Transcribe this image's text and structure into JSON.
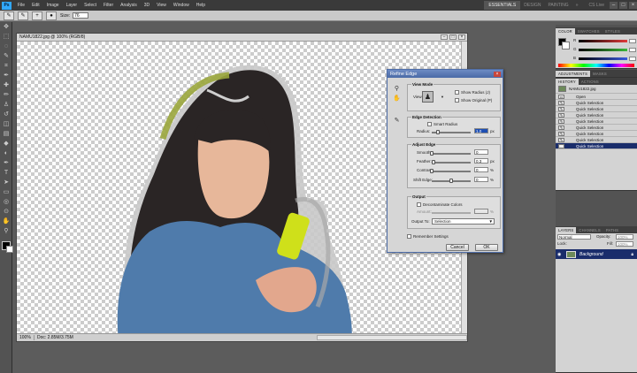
{
  "menubar": {
    "logo": "Ps",
    "items": [
      "File",
      "Edit",
      "Image",
      "Layer",
      "Select",
      "Filter",
      "Analysis",
      "3D",
      "View",
      "Window",
      "Help"
    ],
    "workspaces": [
      "ESSENTIALS",
      "DESIGN",
      "PAINTING",
      "»"
    ],
    "cs_live": "CS Live"
  },
  "options": {
    "size_label": "Size:",
    "size_value": "76"
  },
  "document": {
    "title": "NAMU1822.jpg @ 100% (RGB/8)",
    "zoom": "100%",
    "doc_info": "Doc: 2.85M/3.75M"
  },
  "refine_edge": {
    "title": "Refine Edge",
    "view_mode": {
      "header": "View Mode",
      "view_label": "View:",
      "show_radius": "Show Radius (J)",
      "show_original": "Show Original (P)"
    },
    "edge_detection": {
      "header": "Edge Detection",
      "smart_radius": "Smart Radius",
      "radius_label": "Radius:",
      "radius_value": "1.0",
      "radius_unit": "px"
    },
    "adjust_edge": {
      "header": "Adjust Edge",
      "smooth_label": "Smooth:",
      "smooth_value": "0",
      "feather_label": "Feather:",
      "feather_value": "0.3",
      "feather_unit": "px",
      "contrast_label": "Contrast:",
      "contrast_value": "0",
      "contrast_unit": "%",
      "shift_label": "Shift Edge:",
      "shift_value": "0",
      "shift_unit": "%"
    },
    "output": {
      "header": "Output",
      "decontaminate": "Decontaminate Colors",
      "amount_label": "Amount:",
      "amount_unit": "%",
      "output_to_label": "Output To:",
      "output_to_value": "Selection"
    },
    "remember": "Remember Settings",
    "cancel": "Cancel",
    "ok": "OK"
  },
  "color_panel": {
    "tabs": [
      "COLOR",
      "SWATCHES",
      "STYLES"
    ],
    "channels": [
      {
        "name": "R",
        "color": "#e03a3a",
        "value": 0
      },
      {
        "name": "G",
        "color": "#3ab83a",
        "value": 0
      },
      {
        "name": "B",
        "color": "#3a5ae0",
        "value": 0
      }
    ]
  },
  "adjust_panel": {
    "tabs": [
      "ADJUSTMENTS",
      "MASKS"
    ]
  },
  "history_panel": {
    "tabs": [
      "HISTORY",
      "ACTIONS"
    ],
    "snapshot": "NAMU1822.jpg",
    "items": [
      "Open",
      "Quick Selection",
      "Quick Selection",
      "Quick Selection",
      "Quick Selection",
      "Quick Selection",
      "Quick Selection",
      "Quick Selection",
      "Quick Selection"
    ]
  },
  "layers_panel": {
    "tabs": [
      "LAYERS",
      "CHANNELS",
      "PATHS"
    ],
    "blend_mode": "Normal",
    "opacity_label": "Opacity:",
    "opacity_value": "100%",
    "lock_label": "Lock:",
    "fill_label": "Fill:",
    "fill_value": "100%",
    "layer_name": "Background"
  }
}
